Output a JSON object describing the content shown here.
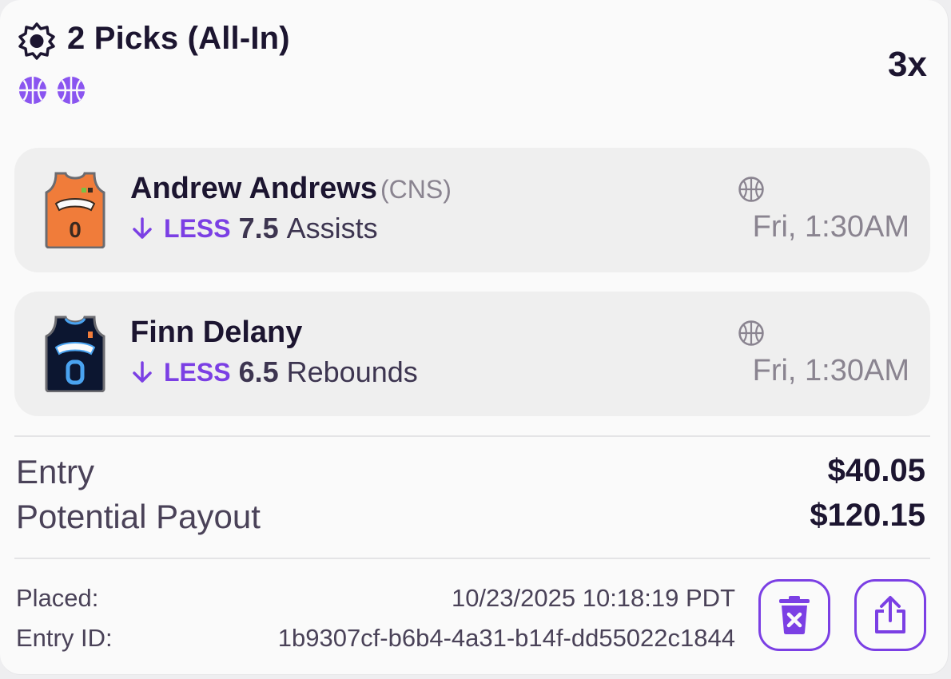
{
  "header": {
    "title": "2 Picks (All-In)",
    "multiplier": "3x",
    "sport_icons": [
      "basketball-icon",
      "basketball-icon"
    ]
  },
  "picks": [
    {
      "player": "Andrew Andrews",
      "team": "(CNS)",
      "direction": "LESS",
      "line": "7.5",
      "stat": "Assists",
      "time": "Fri, 1:30AM",
      "jersey_number": "0",
      "jersey_color": "#f07c3a"
    },
    {
      "player": "Finn Delany",
      "team": "",
      "direction": "LESS",
      "line": "6.5",
      "stat": "Rebounds",
      "time": "Fri, 1:30AM",
      "jersey_number": "0",
      "jersey_color": "#0c1630"
    }
  ],
  "summary": {
    "entry_label": "Entry",
    "entry_value": "$40.05",
    "payout_label": "Potential Payout",
    "payout_value": "$120.15"
  },
  "meta": {
    "placed_label": "Placed:",
    "placed_value": "10/23/2025 10:18:19 PDT",
    "entry_id_label": "Entry ID:",
    "entry_id_value": "1b9307cf-b6b4-4a31-b14f-dd55022c1844"
  },
  "actions": {
    "delete_icon": "trash-icon",
    "share_icon": "share-icon"
  },
  "colors": {
    "accent": "#7b3fe4",
    "text_dark": "#1c1530",
    "text_muted": "#8a8490",
    "card_bg": "#fafafa",
    "pick_bg": "#efefef"
  }
}
